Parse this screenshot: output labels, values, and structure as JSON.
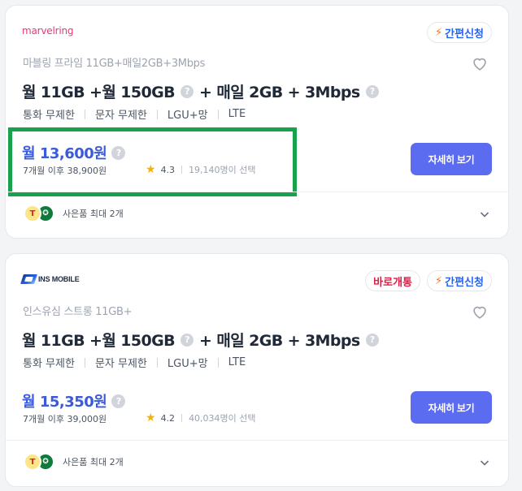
{
  "plans": [
    {
      "logo_text": "marvelring",
      "badges": [
        "간편신청"
      ],
      "subtitle": "마블링 프라임 11GB+매일2GB+3Mbps",
      "title": {
        "part1": "월 11GB +월 150GB",
        "part2": "+ 매일 2GB + 3Mbps"
      },
      "features": [
        "통화 무제한",
        "문자 무제한",
        "LGU+망",
        "LTE"
      ],
      "price": "월 13,600원",
      "after_price": "7개월 이후 38,900원",
      "rating": "4.3",
      "selected_count": "19,140명이 선택",
      "detail_button": "자세히 보기",
      "gift_text": "사은품 최대 2개",
      "highlighted": true
    },
    {
      "logo_text": "INS MOBILE",
      "badges": [
        "바로개통",
        "간편신청"
      ],
      "subtitle": "인스유심 스트롱 11GB+",
      "title": {
        "part1": "월 11GB +월 150GB",
        "part2": "+ 매일 2GB + 3Mbps"
      },
      "features": [
        "통화 무제한",
        "문자 무제한",
        "LGU+망",
        "LTE"
      ],
      "price": "월 15,350원",
      "after_price": "7개월 이후 39,000원",
      "rating": "4.2",
      "selected_count": "40,034명이 선택",
      "detail_button": "자세히 보기",
      "gift_text": "사은품 최대 2개",
      "highlighted": false
    }
  ],
  "icons": {
    "heart": "heart-icon",
    "question": "question-icon",
    "star": "star-icon",
    "chevron": "chevron-down-icon",
    "bolt": "bolt-icon"
  },
  "colors": {
    "price": "#3b5bdb",
    "button": "#5b6cf0",
    "highlight_border": "#16a34a",
    "easy_badge": "#2563eb",
    "instant_badge": "#e11d48"
  }
}
